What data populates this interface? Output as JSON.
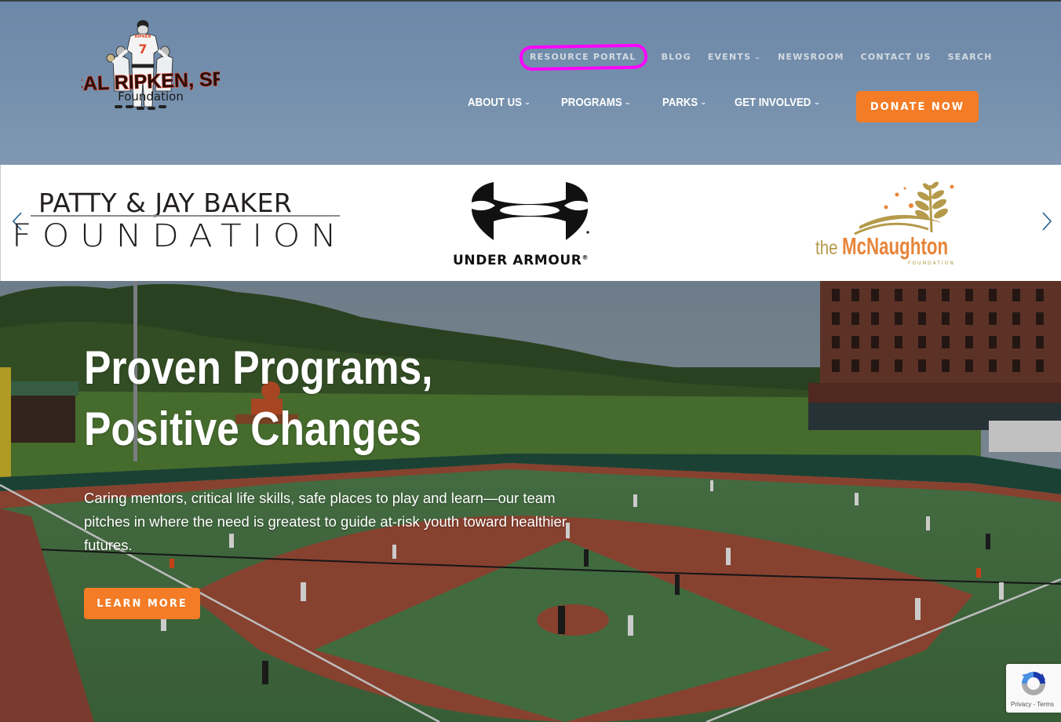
{
  "header": {
    "logo": {
      "title": "CAL RIPKEN, SR.",
      "subtitle": "Foundation",
      "jersey_number": "7"
    },
    "utility_nav": [
      {
        "label": "RESOURCE PORTAL",
        "has_dropdown": false,
        "highlighted": true
      },
      {
        "label": "BLOG",
        "has_dropdown": false
      },
      {
        "label": "EVENTS",
        "has_dropdown": true
      },
      {
        "label": "NEWSROOM",
        "has_dropdown": false
      },
      {
        "label": "CONTACT US",
        "has_dropdown": false
      },
      {
        "label": "SEARCH",
        "has_dropdown": false
      }
    ],
    "main_nav": [
      {
        "label": "ABOUT US",
        "has_dropdown": true
      },
      {
        "label": "PROGRAMS",
        "has_dropdown": true
      },
      {
        "label": "PARKS",
        "has_dropdown": true
      },
      {
        "label": "GET INVOLVED",
        "has_dropdown": true
      }
    ],
    "donate_label": "DONATE NOW",
    "chevron_glyph": "⌄"
  },
  "sponsors": {
    "prev_icon": "chevron-left-icon",
    "next_icon": "chevron-right-icon",
    "items": [
      {
        "name": "Patty & Jay Baker Foundation",
        "line1": "PATTY & JAY BAKER",
        "line2": "FOUNDATION"
      },
      {
        "name": "Under Armour",
        "wordmark": "UNDER ARMOUR",
        "registered": "®"
      },
      {
        "name": "The McNaughton Foundation",
        "prefix": "the",
        "title": "McNaughton",
        "sub": "FOUNDATION"
      }
    ]
  },
  "hero": {
    "title_line1": "Proven Programs,",
    "title_line2": "Positive Changes",
    "description": "Caring mentors, critical life skills, safe places to play and learn—our team pitches in where the need is greatest to guide at-risk youth toward healthier futures.",
    "cta_label": "LEARN MORE"
  },
  "recaptcha": {
    "links": "Privacy - Terms"
  },
  "colors": {
    "accent_orange": "#f47c26",
    "header_blue": "#7590ad",
    "annotation_magenta": "#ff00ff"
  }
}
